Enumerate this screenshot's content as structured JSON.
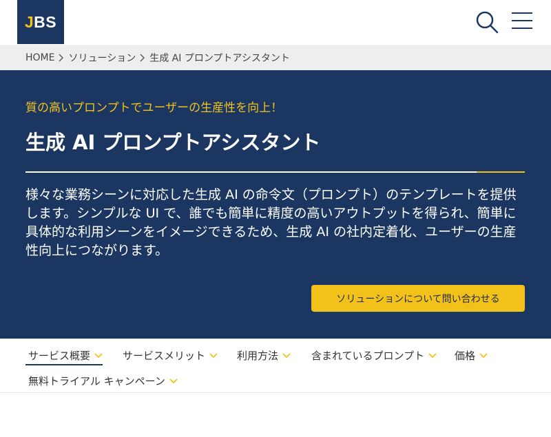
{
  "header": {
    "logo_mark": "J",
    "logo_rest": "BS",
    "search_icon": "search-icon",
    "menu_icon": "hamburger-menu-icon"
  },
  "breadcrumb": {
    "items": [
      "HOME",
      "ソリューション",
      "生成 AI プロンプトアシスタント"
    ]
  },
  "hero": {
    "tagline": "質の高いプロンプトでユーザーの生産性を向上！",
    "title": "生成 AI プロンプトアシスタント",
    "description": "様々な業務シーンに対応した生成 AI の命令文（プロンプト）のテンプレートを提供します。シンプルな UI で、誰でも簡単に精度の高いアウトプットを得られ、簡単に具体的な利用シーンをイメージできるため、生成 AI の社内定着化、ユーザーの生産性向上につながります。",
    "cta_label": "ソリューションについて問い合わせる"
  },
  "tabs": {
    "items": [
      {
        "label": "サービス概要",
        "active": true
      },
      {
        "label": "サービスメリット",
        "active": false
      },
      {
        "label": "利用方法",
        "active": false
      },
      {
        "label": "含まれているプロンプト",
        "active": false
      },
      {
        "label": "価格",
        "active": false
      },
      {
        "label": "無料トライアル キャンペーン",
        "active": false
      }
    ]
  },
  "colors": {
    "navy": "#1b3661",
    "accent_yellow": "#f2c21b",
    "breadcrumb_bg": "#eeeeee"
  }
}
